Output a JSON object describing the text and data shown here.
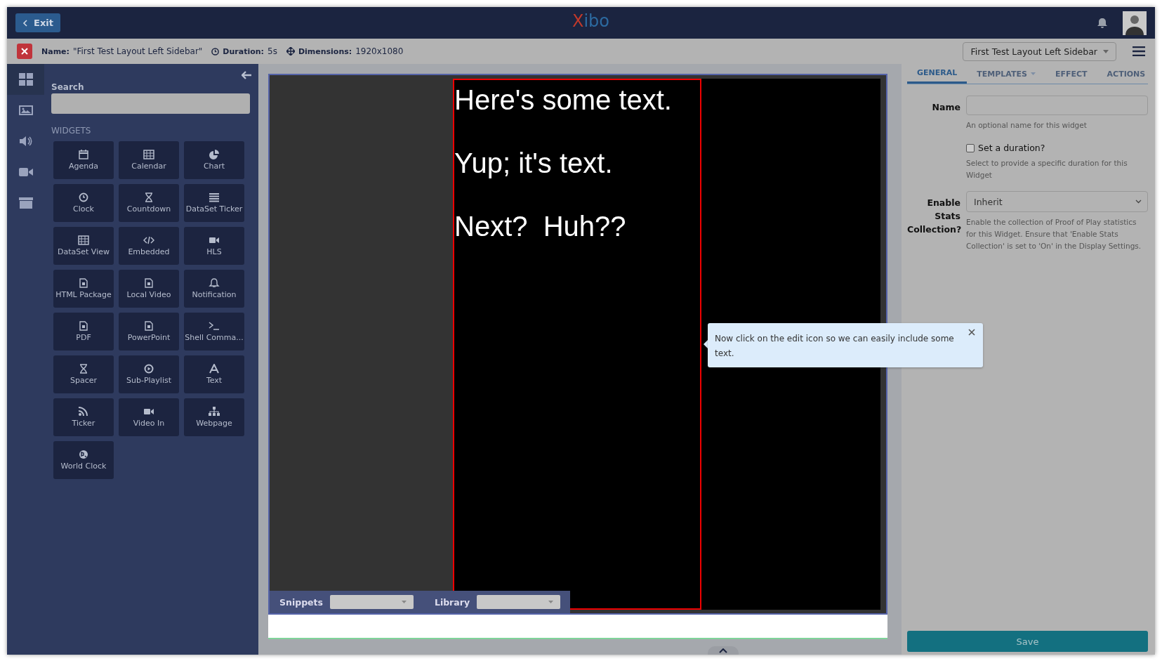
{
  "topbar": {
    "exit_button": "Exit",
    "logo": "Xibo"
  },
  "infobar": {
    "name_label": "Name:",
    "name_value": "\"First Test Layout Left Sidebar\"",
    "duration_label": "Duration:",
    "duration_value": "5s",
    "dimensions_label": "Dimensions:",
    "dimensions_value": "1920x1080",
    "layout_dropdown": "First Test Layout Left Sidebar"
  },
  "sidebar": {
    "nav": [
      {
        "selected": true
      },
      {
        "selected": false
      },
      {
        "selected": false
      },
      {
        "selected": false
      },
      {
        "selected": false
      }
    ],
    "search_label": "Search",
    "section_title": "WIDGETS",
    "widgets": [
      "Agenda",
      "Calendar",
      "Chart",
      "Clock",
      "Countdown",
      "DataSet Ticker",
      "DataSet View",
      "Embedded",
      "HLS",
      "HTML Package",
      "Local Video",
      "Notification",
      "PDF",
      "PowerPoint",
      "Shell Comma...",
      "Spacer",
      "Sub-Playlist",
      "Text",
      "Ticker",
      "Video In",
      "Webpage",
      "World Clock"
    ]
  },
  "canvas": {
    "texts": [
      "Here's some text.",
      "Yup; it's text.",
      "Next?  Huh??"
    ],
    "snippets_label": "Snippets",
    "library_label": "Library"
  },
  "tooltip": {
    "text": "Now click on the edit icon so we can easily include some text."
  },
  "panel": {
    "tabs": [
      {
        "label": "GENERAL",
        "selected": true,
        "dropdown": false
      },
      {
        "label": "TEMPLATES",
        "selected": false,
        "dropdown": true
      },
      {
        "label": "EFFECT",
        "selected": false,
        "dropdown": false
      },
      {
        "label": "ACTIONS",
        "selected": false,
        "dropdown": false
      }
    ],
    "name_label": "Name",
    "name_help": "An optional name for this widget",
    "duration_checkbox": {
      "label": "Set a duration?",
      "checked": false
    },
    "duration_help": "Select to provide a specific duration for this Widget",
    "stats_label": "Enable Stats Collection?",
    "stats_value": "Inherit",
    "stats_help": "Enable the collection of Proof of Play statistics for this Widget. Ensure that 'Enable Stats Collection' is set to 'On' in the Display Settings.",
    "save_button": "Save"
  }
}
